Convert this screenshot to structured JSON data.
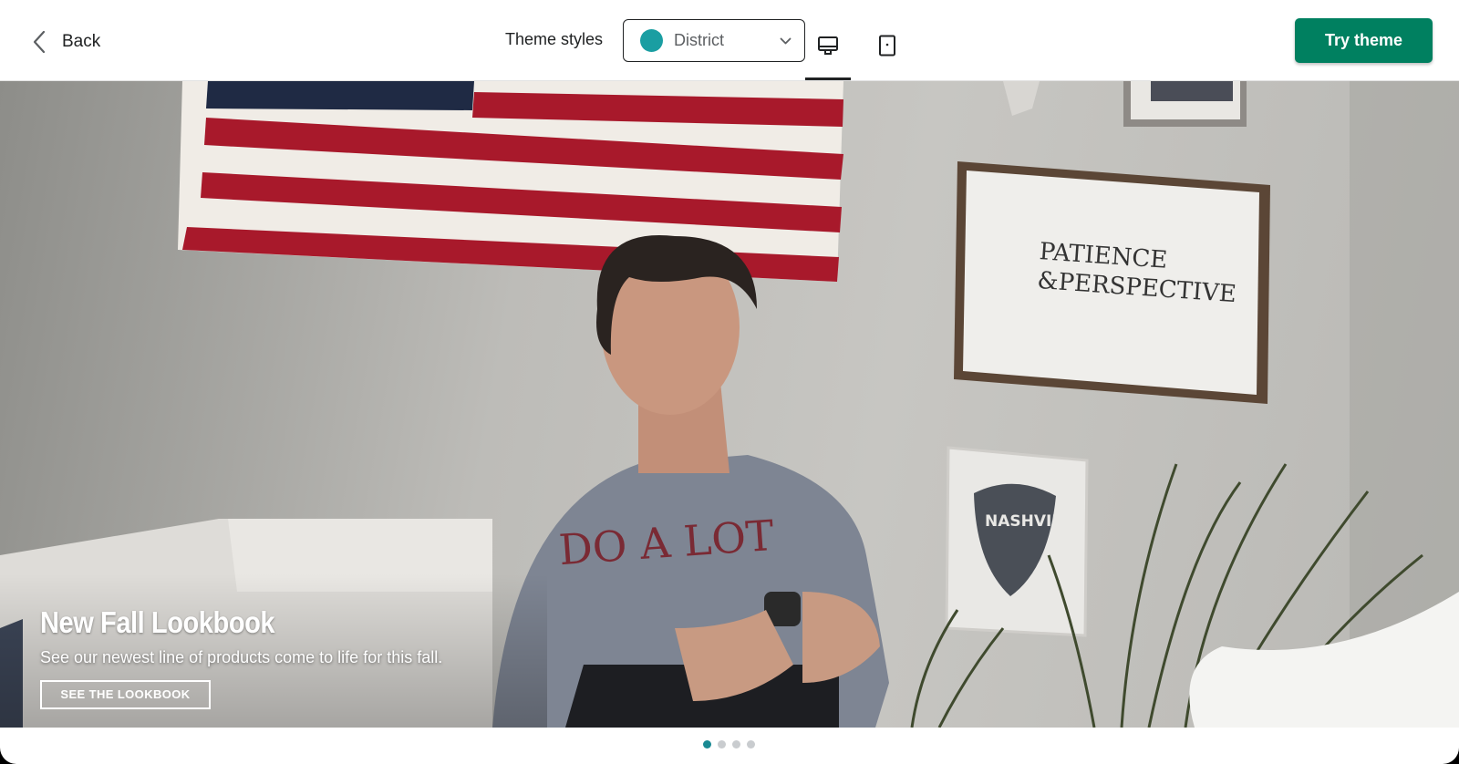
{
  "toolbar": {
    "back_label": "Back",
    "theme_styles_label": "Theme styles",
    "selected_style": "District",
    "selected_style_color": "#1a9ea2",
    "devices": [
      {
        "icon": "desktop-icon",
        "active": true
      },
      {
        "icon": "mobile-icon",
        "active": false
      }
    ],
    "try_theme_label": "Try theme",
    "try_theme_color": "#008060"
  },
  "hero": {
    "title": "New Fall Lookbook",
    "subtitle": "See our newest line of products come to life for this fall.",
    "button_label": "SEE THE LOOKBOOK",
    "wall_art_text": "PATIENCE & PERSPECTIVE",
    "small_frame_text": "NASHVILLE",
    "shirt_text": "DO A LOT WITH A LITTLE"
  },
  "slideshow": {
    "total_slides": 4,
    "active_slide": 1,
    "active_color": "#1a8a93"
  }
}
